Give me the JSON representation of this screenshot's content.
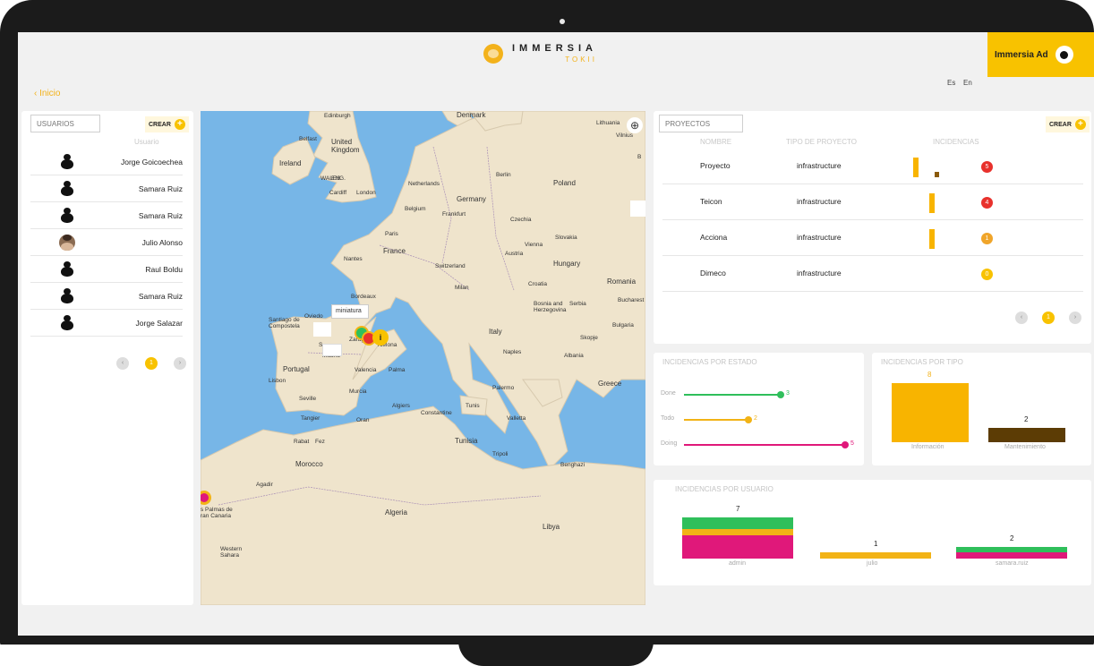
{
  "header": {
    "logo_name": "IMMERSIA",
    "logo_sub": "TOKII",
    "lang_es": "Es",
    "lang_en": "En",
    "user_name": "Immersia Ad"
  },
  "breadcrumb": {
    "back_label": "‹ Inicio"
  },
  "users_panel": {
    "search_placeholder": "USUARIOS",
    "create_label": "CREAR",
    "column_header": "Usuario",
    "rows": [
      {
        "name": "Jorge Goicoechea",
        "avatar": "silhouette"
      },
      {
        "name": "Samara Ruiz",
        "avatar": "silhouette"
      },
      {
        "name": "Samara Ruiz",
        "avatar": "silhouette"
      },
      {
        "name": "Julio Alonso",
        "avatar": "photo"
      },
      {
        "name": "Raul Boldu",
        "avatar": "silhouette"
      },
      {
        "name": "Samara Ruiz",
        "avatar": "silhouette"
      },
      {
        "name": "Jorge Salazar",
        "avatar": "silhouette"
      }
    ],
    "pagination": {
      "prev": "‹",
      "current": "1",
      "next": "›"
    }
  },
  "map": {
    "labels": {
      "edinburgh": "Edinburgh",
      "belfast": "Belfast",
      "united_kingdom": "United Kingdom",
      "ireland": "Ireland",
      "wales": "WALES",
      "eng": "ENG.",
      "cardiff": "Cardiff",
      "london": "London",
      "denmark": "Denmark",
      "lithuania": "Lithuania",
      "vilnius": "Vilnius",
      "netherlands": "Netherlands",
      "berlin": "Berlin",
      "poland": "Poland",
      "germany": "Germany",
      "belgium": "Belgium",
      "frankfurt": "Frankfurt",
      "czechia": "Czechia",
      "paris": "Paris",
      "slovakia": "Slovakia",
      "vienna": "Vienna",
      "austria": "Austria",
      "france": "France",
      "nantes": "Nantes",
      "hungary": "Hungary",
      "switzerland": "Switzerland",
      "milan": "Milan",
      "croatia": "Croatia",
      "romania": "Romania",
      "bordeaux": "Bordeaux",
      "bosnia": "Bosnia and Herzegovina",
      "serbia": "Serbia",
      "bucharest": "Bucharest",
      "santiago": "Santiago de Compostela",
      "oviedo": "Oviedo",
      "italy": "Italy",
      "bulgaria": "Bulgaria",
      "skopje": "Skopje",
      "zaragoza": "Zarag",
      "barcelona": "rcelona",
      "madrid": "Madrid",
      "albania": "Albania",
      "portugal": "Portugal",
      "lisbon": "Lisbon",
      "valencia": "Valencia",
      "palma": "Palma",
      "naples": "Naples",
      "murcia": "Murcia",
      "seville": "Seville",
      "greece": "Greece",
      "palermo": "Palermo",
      "algiers": "Algiers",
      "tunis": "Tunis",
      "constantine": "Constantine",
      "valletta": "Valletta",
      "tangier": "Tangier",
      "oran": "Oran",
      "rabat": "Rabat",
      "fez": "Fez",
      "tunisia": "Tunisia",
      "tripoli": "Tripoli",
      "morocco": "Morocco",
      "benghazi": "Benghazi",
      "agadir": "Agadir",
      "algeria": "Algeria",
      "libya": "Libya",
      "las_palmas": "s Palmas de ran Canaria",
      "western_sahara": "Western Sahara",
      "b": "B",
      "s": "S"
    },
    "popup_label": "miniatura",
    "marker_i": "i"
  },
  "projects_panel": {
    "search_placeholder": "PROYECTOS",
    "create_label": "CREAR",
    "headers": {
      "name": "NOMBRE",
      "type": "TIPO DE PROYECTO",
      "incidents": "INCIDENCIAS"
    },
    "rows": [
      {
        "name": "Proyecto",
        "type": "infrastructure",
        "count": "5",
        "color": "#e8312c"
      },
      {
        "name": "Teicon",
        "type": "infrastructure",
        "count": "4",
        "color": "#e8312c"
      },
      {
        "name": "Acciona",
        "type": "infrastructure",
        "count": "1",
        "color": "#f0a52a"
      },
      {
        "name": "Dimeco",
        "type": "infrastructure",
        "count": "0",
        "color": "#f8c200"
      }
    ],
    "pagination": {
      "prev": "‹",
      "current": "1",
      "next": "›"
    }
  },
  "estado_chart": {
    "title": "INCIDENCIAS POR ESTADO",
    "chart_data": {
      "type": "bar",
      "categories": [
        "Done",
        "Todo",
        "Doing"
      ],
      "values": [
        3,
        2,
        5
      ],
      "colors": [
        "#2fbf5b",
        "#f2b316",
        "#e0187a"
      ],
      "xlim": [
        0,
        5
      ]
    }
  },
  "tipo_chart": {
    "title": "INCIDENCIAS POR TIPO",
    "chart_data": {
      "type": "bar",
      "categories": [
        "Información",
        "Mantenimiento"
      ],
      "values": [
        8,
        2
      ],
      "colors": [
        "#f8b400",
        "#5c3c05"
      ],
      "ylim": [
        0,
        8
      ]
    }
  },
  "usuario_chart": {
    "title": "INCIDENCIAS POR USUARIO",
    "chart_data": {
      "type": "bar",
      "categories": [
        "admin",
        "julio",
        "samara.ruiz"
      ],
      "totals": [
        7,
        1,
        2
      ],
      "stack_colors": {
        "Doing": "#e0187a",
        "Todo": "#f2b316",
        "Done": "#2fbf5b"
      },
      "stacks": [
        {
          "Doing": 4,
          "Todo": 1,
          "Done": 2
        },
        {
          "Doing": 0,
          "Todo": 1,
          "Done": 0
        },
        {
          "Doing": 1,
          "Todo": 0,
          "Done": 1
        }
      ],
      "ylim": [
        0,
        7
      ]
    }
  }
}
